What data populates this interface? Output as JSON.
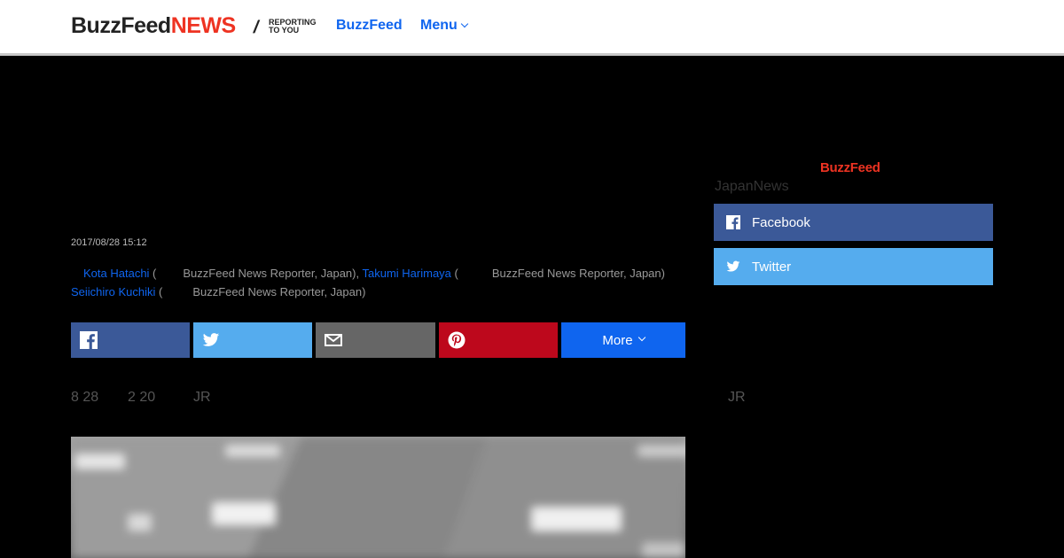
{
  "header": {
    "logo_primary": "BuzzFeed",
    "logo_secondary": "NEWS",
    "logo_tagline": "REPORTING TO YOU",
    "nav_buzzfeed": "BuzzFeed",
    "nav_menu": "Menu"
  },
  "article": {
    "date": "2017/08/28 15:12",
    "authors": [
      {
        "name": "Kota Hatachi",
        "role": "BuzzFeed News Reporter, Japan"
      },
      {
        "name": "Takumi Harimaya",
        "role": "BuzzFeed News Reporter, Japan"
      },
      {
        "name": "Seiichiro Kuchiki",
        "role": "BuzzFeed News Reporter, Japan"
      }
    ],
    "intro_fragments": [
      "8  28",
      "2  20",
      "JR"
    ]
  },
  "share": {
    "more_label": "More",
    "icons": [
      "facebook-icon",
      "twitter-icon",
      "email-icon",
      "pinterest-icon"
    ]
  },
  "sidebar": {
    "logo": "BuzzFeed",
    "label": "JapanNews",
    "facebook_label": "Facebook",
    "twitter_label": "Twitter",
    "trailing_fragment": "JR"
  },
  "colors": {
    "accent_blue": "#0f65ef",
    "facebook": "#3b5998",
    "twitter": "#55acee",
    "email": "#666666",
    "pinterest": "#bd081c",
    "brand_red": "#ee3322"
  }
}
